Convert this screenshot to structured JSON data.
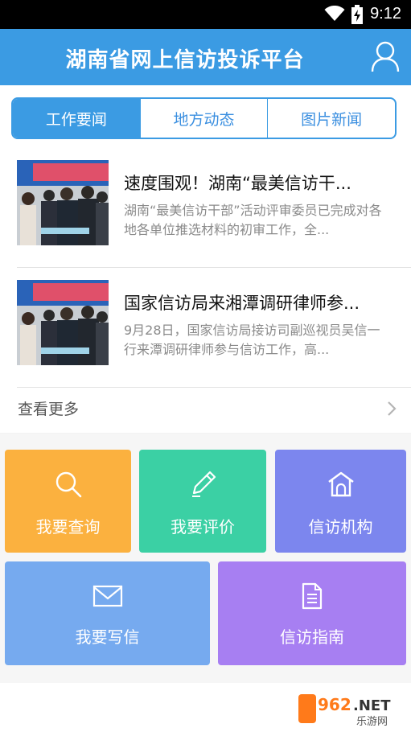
{
  "status_bar": {
    "time": "9:12"
  },
  "header": {
    "title": "湖南省网上信访投诉平台"
  },
  "tabs": [
    {
      "label": "工作要闻",
      "active": true
    },
    {
      "label": "地方动态",
      "active": false
    },
    {
      "label": "图片新闻",
      "active": false
    }
  ],
  "news": [
    {
      "title": "速度围观！湖南“最美信访干...",
      "summary": "湖南“最美信访干部”活动评审委员已完成对各地各单位推选材料的初审工作，全..."
    },
    {
      "title": "国家信访局来湘潭调研律师参...",
      "summary": "9月28日，国家信访局接访司副巡视员吴信一行来潭调研律师参与信访工作，高..."
    }
  ],
  "more": {
    "label": "查看更多"
  },
  "tiles": [
    {
      "label": "我要查询",
      "icon": "search-icon",
      "color": "#fbb13f"
    },
    {
      "label": "我要评价",
      "icon": "pen-icon",
      "color": "#3bd0a4"
    },
    {
      "label": "信访机构",
      "icon": "house-icon",
      "color": "#7c86ee"
    },
    {
      "label": "我要写信",
      "icon": "mail-icon",
      "color": "#76aaef"
    },
    {
      "label": "信访指南",
      "icon": "document-icon",
      "color": "#a77ff2"
    }
  ],
  "watermark": {
    "brand": "962.NET",
    "text": "乐游网"
  },
  "colors": {
    "primary": "#3b9be3"
  }
}
